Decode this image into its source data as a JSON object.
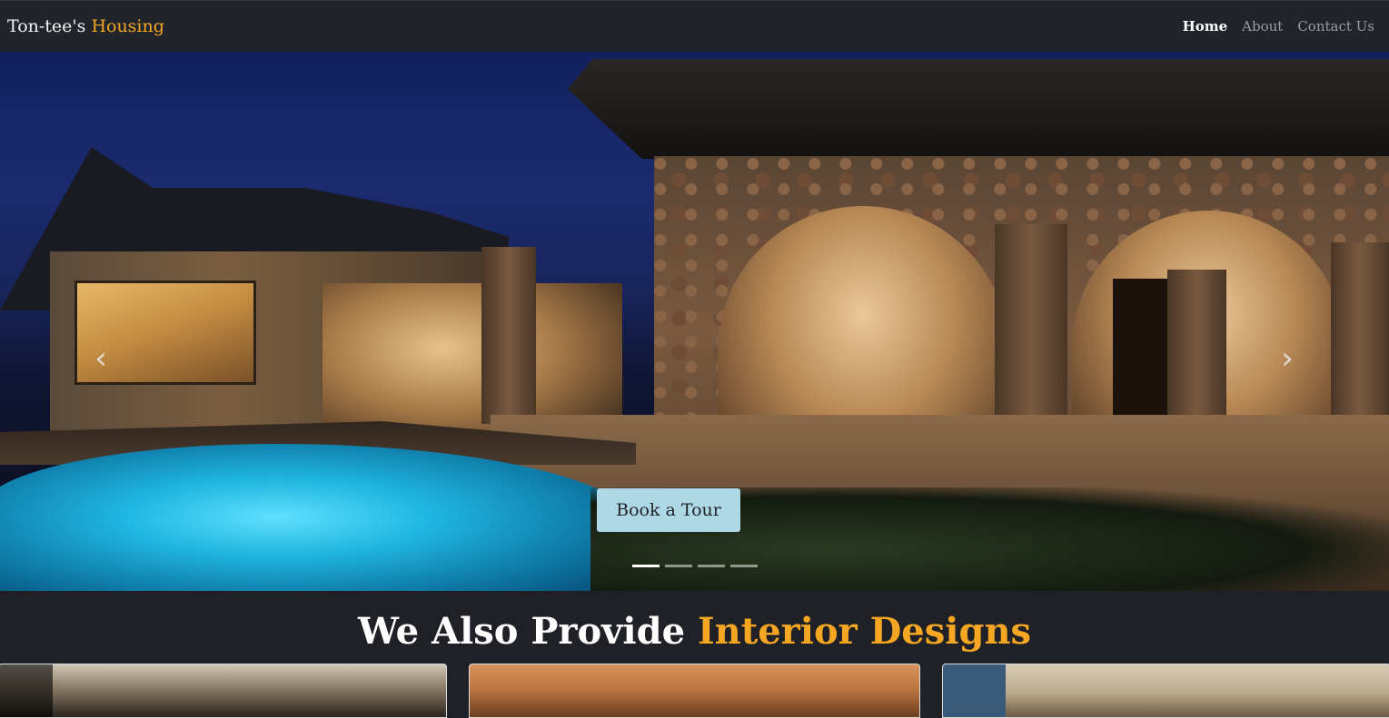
{
  "navbar": {
    "brand_main": "Ton-tee's",
    "brand_accent": "Housing",
    "links": [
      {
        "label": "Home",
        "active": true
      },
      {
        "label": "About",
        "active": false
      },
      {
        "label": "Contact Us",
        "active": false
      }
    ]
  },
  "hero": {
    "cta_label": "Book a Tour",
    "prev_icon": "‹",
    "next_icon": "›",
    "slide_count": 4,
    "active_slide": 1
  },
  "section": {
    "title_main": "We Also Provide",
    "title_accent": "Interior Designs"
  },
  "colors": {
    "accent": "#f5a623",
    "background": "#1f2126",
    "cta": "#add8e6"
  }
}
